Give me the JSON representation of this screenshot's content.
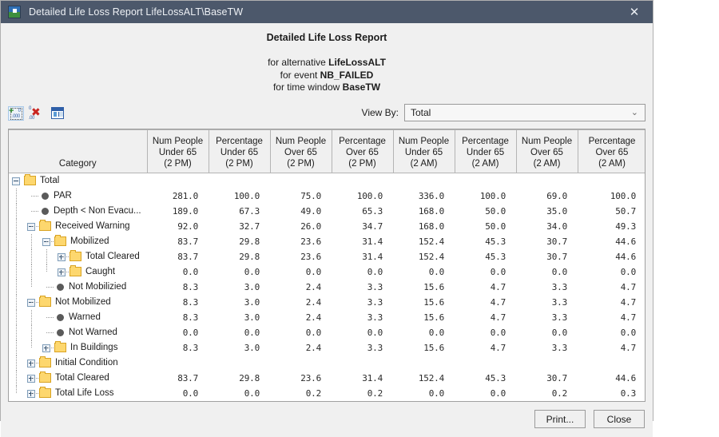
{
  "window": {
    "title": "Detailed Life Loss Report LifeLossALT\\BaseTW",
    "app_icon": "map-icon",
    "close_icon": "✕"
  },
  "report": {
    "title": "Detailed Life Loss Report",
    "line1_prefix": "for alternative ",
    "line1_value": "LifeLossALT",
    "line2_prefix": "for event ",
    "line2_value": "NB_FAILED",
    "line3_prefix": "for time window ",
    "line3_value": "BaseTW"
  },
  "toolbar": {
    "add_decimal_icon": "add-decimal-icon",
    "remove_decimal_icon": "remove-decimal-icon",
    "columns_icon": "columns-icon",
    "viewby_label": "View By:",
    "viewby_value": "Total",
    "viewby_arrow": "⌄"
  },
  "table": {
    "headers": [
      {
        "l1": "",
        "l2": "",
        "l3": "Category"
      },
      {
        "l1": "Num People",
        "l2": "Under 65",
        "l3": "(2 PM)"
      },
      {
        "l1": "Percentage",
        "l2": "Under 65",
        "l3": "(2 PM)"
      },
      {
        "l1": "Num People",
        "l2": "Over 65",
        "l3": "(2 PM)"
      },
      {
        "l1": "Percentage",
        "l2": "Over 65",
        "l3": "(2 PM)"
      },
      {
        "l1": "Num People",
        "l2": "Under 65",
        "l3": "(2 AM)"
      },
      {
        "l1": "Percentage",
        "l2": "Under 65",
        "l3": "(2 AM)"
      },
      {
        "l1": "Num People",
        "l2": "Over 65",
        "l3": "(2 AM)"
      },
      {
        "l1": "Percentage",
        "l2": "Over 65",
        "l3": "(2 AM)"
      }
    ],
    "rows": [
      {
        "label": "Total",
        "depth": 0,
        "icon": "folder",
        "toggle": "minus",
        "values": [
          "",
          "",
          "",
          "",
          "",
          "",
          "",
          ""
        ]
      },
      {
        "label": "PAR",
        "depth": 1,
        "icon": "bullet",
        "toggle": "none",
        "values": [
          "281.0",
          "100.0",
          "75.0",
          "100.0",
          "336.0",
          "100.0",
          "69.0",
          "100.0"
        ]
      },
      {
        "label": "Depth < Non Evacu...",
        "depth": 1,
        "icon": "bullet",
        "toggle": "none",
        "values": [
          "189.0",
          "67.3",
          "49.0",
          "65.3",
          "168.0",
          "50.0",
          "35.0",
          "50.7"
        ]
      },
      {
        "label": "Received Warning",
        "depth": 1,
        "icon": "folder",
        "toggle": "minus",
        "values": [
          "92.0",
          "32.7",
          "26.0",
          "34.7",
          "168.0",
          "50.0",
          "34.0",
          "49.3"
        ]
      },
      {
        "label": "Mobilized",
        "depth": 2,
        "icon": "folder",
        "toggle": "minus",
        "values": [
          "83.7",
          "29.8",
          "23.6",
          "31.4",
          "152.4",
          "45.3",
          "30.7",
          "44.6"
        ]
      },
      {
        "label": "Total Cleared",
        "depth": 3,
        "icon": "folder",
        "toggle": "plus",
        "values": [
          "83.7",
          "29.8",
          "23.6",
          "31.4",
          "152.4",
          "45.3",
          "30.7",
          "44.6"
        ]
      },
      {
        "label": "Caught",
        "depth": 3,
        "icon": "folder",
        "toggle": "plus",
        "values": [
          "0.0",
          "0.0",
          "0.0",
          "0.0",
          "0.0",
          "0.0",
          "0.0",
          "0.0"
        ]
      },
      {
        "label": "Not Mobilizied",
        "depth": 2,
        "icon": "bullet",
        "toggle": "none",
        "values": [
          "8.3",
          "3.0",
          "2.4",
          "3.3",
          "15.6",
          "4.7",
          "3.3",
          "4.7"
        ]
      },
      {
        "label": "Not Mobilized",
        "depth": 1,
        "icon": "folder",
        "toggle": "minus",
        "values": [
          "8.3",
          "3.0",
          "2.4",
          "3.3",
          "15.6",
          "4.7",
          "3.3",
          "4.7"
        ]
      },
      {
        "label": "Warned",
        "depth": 2,
        "icon": "bullet",
        "toggle": "none",
        "values": [
          "8.3",
          "3.0",
          "2.4",
          "3.3",
          "15.6",
          "4.7",
          "3.3",
          "4.7"
        ]
      },
      {
        "label": "Not Warned",
        "depth": 2,
        "icon": "bullet",
        "toggle": "none",
        "values": [
          "0.0",
          "0.0",
          "0.0",
          "0.0",
          "0.0",
          "0.0",
          "0.0",
          "0.0"
        ]
      },
      {
        "label": "In Buildings",
        "depth": 2,
        "icon": "folder",
        "toggle": "plus",
        "values": [
          "8.3",
          "3.0",
          "2.4",
          "3.3",
          "15.6",
          "4.7",
          "3.3",
          "4.7"
        ]
      },
      {
        "label": "Initial Condition",
        "depth": 1,
        "icon": "folder",
        "toggle": "plus",
        "values": [
          "",
          "",
          "",
          "",
          "",
          "",
          "",
          ""
        ]
      },
      {
        "label": "Total Cleared",
        "depth": 1,
        "icon": "folder",
        "toggle": "plus",
        "values": [
          "83.7",
          "29.8",
          "23.6",
          "31.4",
          "152.4",
          "45.3",
          "30.7",
          "44.6"
        ]
      },
      {
        "label": "Total Life Loss",
        "depth": 1,
        "icon": "folder",
        "toggle": "plus",
        "values": [
          "0.0",
          "0.0",
          "0.2",
          "0.2",
          "0.0",
          "0.0",
          "0.2",
          "0.3"
        ]
      }
    ]
  },
  "footer": {
    "print_label": "Print...",
    "close_label": "Close"
  },
  "colors": {
    "titlebar": "#4c586b",
    "folder": "#fdd76e",
    "panel": "#f0f0f0"
  }
}
